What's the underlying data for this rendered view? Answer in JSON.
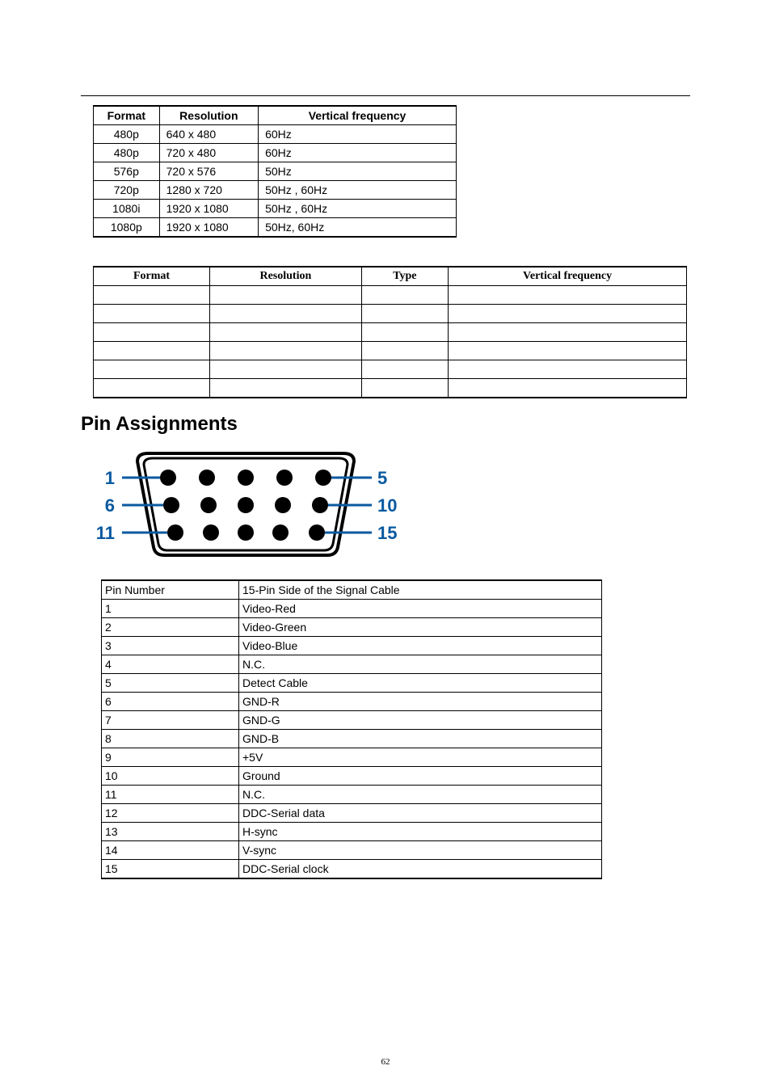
{
  "table1": {
    "headers": {
      "format": "Format",
      "resolution": "Resolution",
      "vf": "Vertical frequency"
    },
    "rows": [
      {
        "format": "480p",
        "resolution": "640 x 480",
        "vf": "60Hz"
      },
      {
        "format": "480p",
        "resolution": "720 x 480",
        "vf": "60Hz"
      },
      {
        "format": "576p",
        "resolution": "720 x 576",
        "vf": "50Hz"
      },
      {
        "format": "720p",
        "resolution": "1280 x 720",
        "vf": "50Hz , 60Hz"
      },
      {
        "format": "1080i",
        "resolution": "1920 x 1080",
        "vf": "50Hz , 60Hz"
      },
      {
        "format": "1080p",
        "resolution": "1920 x 1080",
        "vf": "50Hz, 60Hz"
      }
    ]
  },
  "table2": {
    "headers": {
      "format": "Format",
      "resolution": "Resolution",
      "type": "Type",
      "vf": "Vertical frequency"
    },
    "rows": [
      {
        "format": "",
        "resolution": "",
        "type": "",
        "vf": ""
      },
      {
        "format": "",
        "resolution": "",
        "type": "",
        "vf": ""
      },
      {
        "format": "",
        "resolution": "",
        "type": "",
        "vf": ""
      },
      {
        "format": "",
        "resolution": "",
        "type": "",
        "vf": ""
      },
      {
        "format": "",
        "resolution": "",
        "type": "",
        "vf": ""
      },
      {
        "format": "",
        "resolution": "",
        "type": "",
        "vf": ""
      }
    ]
  },
  "heading": "Pin Assignments",
  "diagram": {
    "labels": {
      "l1": "1",
      "l6": "6",
      "l11": "11",
      "l5": "5",
      "l10": "10",
      "l15": "15"
    }
  },
  "table3": {
    "headers": {
      "pin": "Pin Number",
      "desc": "15-Pin Side of the Signal Cable"
    },
    "rows": [
      {
        "pin": "1",
        "desc": "Video-Red"
      },
      {
        "pin": "2",
        "desc": "Video-Green"
      },
      {
        "pin": "3",
        "desc": "Video-Blue"
      },
      {
        "pin": "4",
        "desc": "N.C."
      },
      {
        "pin": "5",
        "desc": "Detect Cable"
      },
      {
        "pin": "6",
        "desc": "GND-R"
      },
      {
        "pin": "7",
        "desc": "GND-G"
      },
      {
        "pin": "8",
        "desc": "GND-B"
      },
      {
        "pin": "9",
        "desc": "+5V"
      },
      {
        "pin": "10",
        "desc": "Ground"
      },
      {
        "pin": "11",
        "desc": "N.C."
      },
      {
        "pin": "12",
        "desc": "DDC-Serial data"
      },
      {
        "pin": "13",
        "desc": "H-sync"
      },
      {
        "pin": "14",
        "desc": "V-sync"
      },
      {
        "pin": "15",
        "desc": "DDC-Serial clock"
      }
    ]
  },
  "pageNumber": "62"
}
